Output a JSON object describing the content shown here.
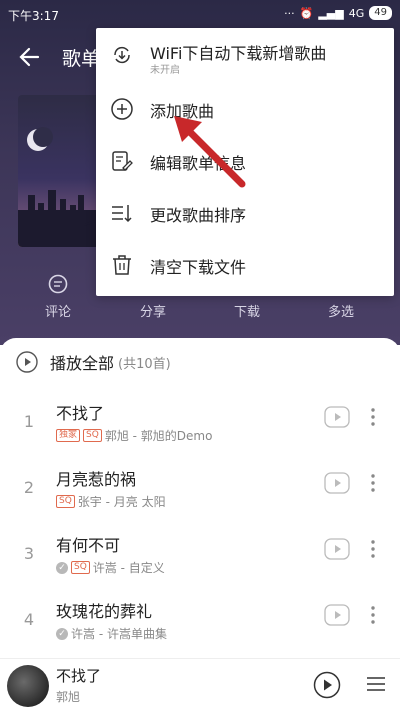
{
  "status_bar": {
    "time": "下午3:17",
    "network": "4G",
    "battery": "49"
  },
  "header": {
    "title": "歌单"
  },
  "actions": [
    {
      "label": "评论",
      "icon": "comment-icon"
    },
    {
      "label": "分享",
      "icon": "share-icon"
    },
    {
      "label": "下载",
      "icon": "download-icon"
    },
    {
      "label": "多选",
      "icon": "multiselect-icon"
    }
  ],
  "menu": {
    "items": [
      {
        "label": "WiFi下自动下载新增歌曲",
        "sub": "未开启",
        "icon": "wifi-download-icon"
      },
      {
        "label": "添加歌曲",
        "icon": "add-circle-icon"
      },
      {
        "label": "编辑歌单信息",
        "icon": "edit-icon"
      },
      {
        "label": "更改歌曲排序",
        "icon": "sort-icon"
      },
      {
        "label": "清空下载文件",
        "icon": "trash-icon"
      }
    ]
  },
  "play_all": {
    "label": "播放全部",
    "count": "(共10首)"
  },
  "songs": [
    {
      "num": "1",
      "title": "不找了",
      "badges": [
        "独家",
        "SQ"
      ],
      "check": false,
      "meta": "郭旭 - 郭旭的Demo"
    },
    {
      "num": "2",
      "title": "月亮惹的祸",
      "badges": [
        "SQ"
      ],
      "check": false,
      "meta": "张宇 - 月亮 太阳"
    },
    {
      "num": "3",
      "title": "有何不可",
      "badges": [
        "SQ"
      ],
      "check": true,
      "meta": "许嵩 - 自定义"
    },
    {
      "num": "4",
      "title": "玫瑰花的葬礼",
      "badges": [],
      "check": true,
      "meta": "许嵩 - 许嵩单曲集"
    }
  ],
  "player": {
    "title": "不找了",
    "artist": "郭旭"
  },
  "colors": {
    "accent_red": "#e06a4e",
    "arrow_red": "#c8282a",
    "header_bg": "#3d3658"
  }
}
